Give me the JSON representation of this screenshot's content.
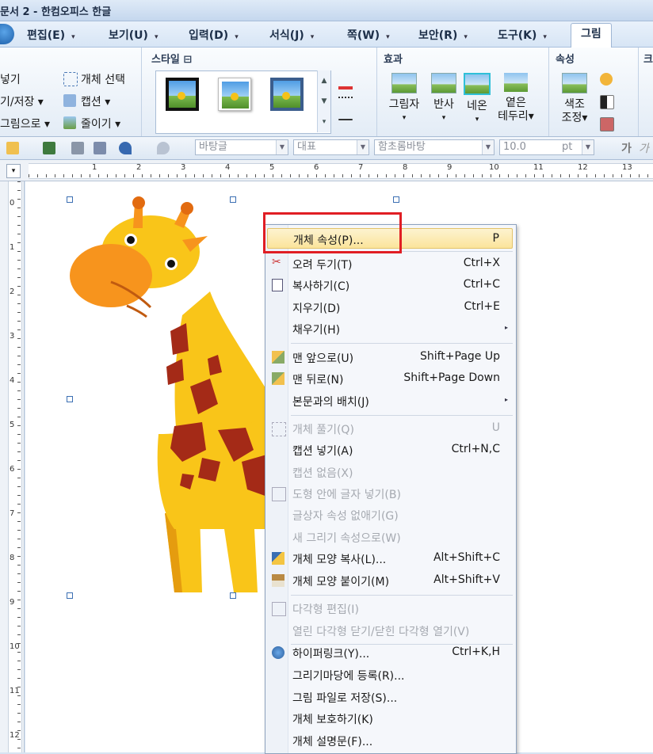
{
  "window": {
    "title": "문서 2 - 한컴오피스 한글"
  },
  "menubar": {
    "file_glyph": "",
    "items": [
      {
        "label": "편집(E)"
      },
      {
        "label": "보기(U)"
      },
      {
        "label": "입력(D)"
      },
      {
        "label": "서식(J)"
      },
      {
        "label": "쪽(W)"
      },
      {
        "label": "보안(R)"
      },
      {
        "label": "도구(K)"
      },
      {
        "label": "그림"
      }
    ],
    "dropdown_arrow": "▾"
  },
  "ribbon": {
    "insert_group": {
      "items": [
        "넣기",
        "기/저장 ▾",
        "그림으로 ▾"
      ],
      "right_items": [
        "개체 선택",
        "캡션 ▾",
        "줄이기 ▾"
      ]
    },
    "style_group": {
      "label": "스타일 ⊟"
    },
    "effect_group": {
      "label": "효과",
      "buttons": [
        {
          "label": "그림자",
          "arrow": "▾"
        },
        {
          "label": "반사",
          "arrow": "▾"
        },
        {
          "label": "네온",
          "arrow": "▾"
        },
        {
          "label": "옅은\n테두리▾"
        }
      ]
    },
    "property_group": {
      "label": "속성",
      "button": {
        "label": "색조\n조정▾"
      }
    },
    "next_group": {
      "label": "크"
    }
  },
  "toolbar2": {
    "style_combo": "바탕글",
    "char_style_combo": "대표",
    "font_combo": "함초롬바탕",
    "size_combo": "10.0",
    "size_unit": "pt",
    "bold_glyph": "가",
    "extra_glyph": "가"
  },
  "ruler": {
    "corner_glyph": "▾",
    "h_numbers": [
      "1",
      "2",
      "3",
      "4",
      "5",
      "6",
      "7",
      "8",
      "9",
      "10",
      "11",
      "12",
      "13"
    ],
    "v_numbers": [
      "0",
      "1",
      "2",
      "3",
      "4",
      "5",
      "6",
      "7",
      "8",
      "9",
      "10",
      "11",
      "12"
    ]
  },
  "context_menu": {
    "items": [
      {
        "label": "개체 속성(P)...",
        "shortcut": "P",
        "disabled": false,
        "highlighted": true,
        "icon": ""
      },
      {
        "label": "오려 두기(T)",
        "shortcut": "Ctrl+X",
        "disabled": false,
        "icon": "scissors-icon"
      },
      {
        "label": "복사하기(C)",
        "shortcut": "Ctrl+C",
        "disabled": false,
        "icon": "copy-icon"
      },
      {
        "label": "지우기(D)",
        "shortcut": "Ctrl+E",
        "disabled": false,
        "icon": ""
      },
      {
        "label": "채우기(H)",
        "shortcut": "",
        "disabled": false,
        "submenu": true,
        "icon": ""
      },
      {
        "label": "맨 앞으로(U)",
        "shortcut": "Shift+Page Up",
        "disabled": false,
        "icon": "bring-front-icon"
      },
      {
        "label": "맨 뒤로(N)",
        "shortcut": "Shift+Page Down",
        "disabled": false,
        "icon": "send-back-icon"
      },
      {
        "label": "본문과의 배치(J)",
        "shortcut": "",
        "disabled": false,
        "submenu": true,
        "icon": ""
      },
      {
        "label": "개체 풀기(Q)",
        "shortcut": "U",
        "disabled": true,
        "icon": "ungroup-icon"
      },
      {
        "label": "캡션 넣기(A)",
        "shortcut": "Ctrl+N,C",
        "disabled": false,
        "icon": ""
      },
      {
        "label": "캡션 없음(X)",
        "shortcut": "",
        "disabled": true,
        "icon": ""
      },
      {
        "label": "도형 안에 글자 넣기(B)",
        "shortcut": "",
        "disabled": true,
        "icon": "text-in-shape-icon"
      },
      {
        "label": "글상자 속성 없애기(G)",
        "shortcut": "",
        "disabled": true,
        "icon": ""
      },
      {
        "label": "새 그리기 속성으로(W)",
        "shortcut": "",
        "disabled": true,
        "icon": ""
      },
      {
        "label": "개체 모양 복사(L)...",
        "shortcut": "Alt+Shift+C",
        "disabled": false,
        "icon": "copy-format-icon"
      },
      {
        "label": "개체 모양 붙이기(M)",
        "shortcut": "Alt+Shift+V",
        "disabled": false,
        "icon": "paste-format-icon"
      },
      {
        "label": "다각형 편집(I)",
        "shortcut": "",
        "disabled": true,
        "icon": "polygon-edit-icon"
      },
      {
        "label": "열린 다각형 닫기/닫힌 다각형 열기(V)",
        "shortcut": "",
        "disabled": true,
        "icon": ""
      },
      {
        "label": "하이퍼링크(Y)...",
        "shortcut": "Ctrl+K,H",
        "disabled": false,
        "icon": "hyperlink-icon"
      },
      {
        "label": "그리기마당에 등록(R)...",
        "shortcut": "",
        "disabled": false,
        "icon": ""
      },
      {
        "label": "그림 파일로 저장(S)...",
        "shortcut": "",
        "disabled": false,
        "icon": ""
      },
      {
        "label": "개체 보호하기(K)",
        "shortcut": "",
        "disabled": false,
        "icon": ""
      },
      {
        "label": "개체 설명문(F)...",
        "shortcut": "",
        "disabled": false,
        "icon": ""
      }
    ],
    "submenu_arrow": "▸"
  },
  "colors": {
    "highlight_box": "#e01e24",
    "giraffe_body": "#f9c519",
    "giraffe_face": "#f7941d",
    "giraffe_spots": "#a42a17"
  }
}
